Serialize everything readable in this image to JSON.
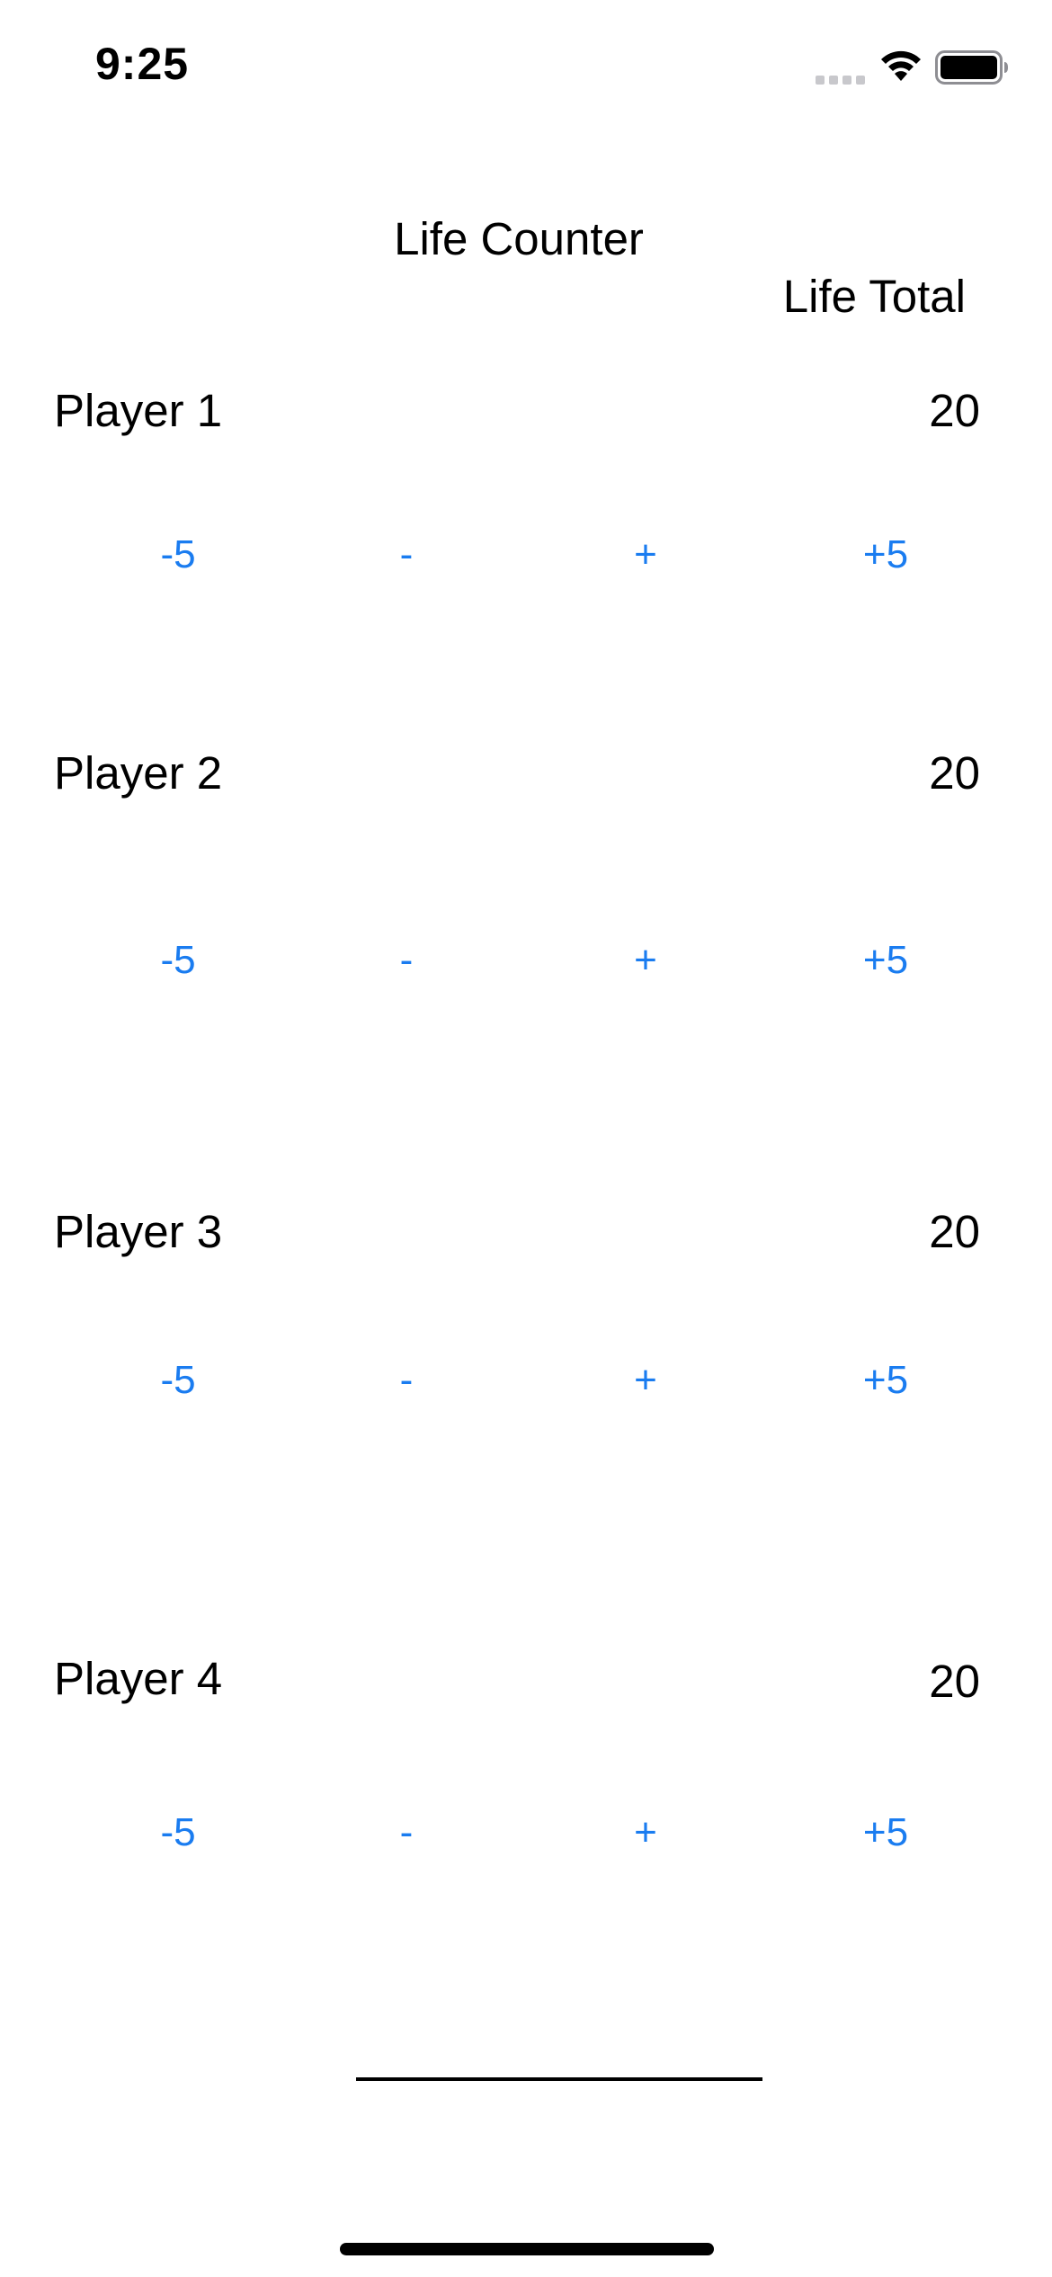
{
  "status_bar": {
    "time": "9:25",
    "icons": [
      "cellular-signal-icon",
      "wifi-icon",
      "battery-icon"
    ]
  },
  "title": "Life Counter",
  "life_total_header": "Life Total",
  "players": [
    {
      "name": "Player 1",
      "total": "20"
    },
    {
      "name": "Player 2",
      "total": "20"
    },
    {
      "name": "Player 3",
      "total": "20"
    },
    {
      "name": "Player 4",
      "total": "20"
    }
  ],
  "buttons": {
    "minus5": "-5",
    "minus1": "-",
    "plus1": "+",
    "plus5": "+5"
  },
  "text_field": {
    "value": ""
  },
  "colors": {
    "accent": "#1a7cf0",
    "text": "#000000",
    "background": "#ffffff"
  }
}
